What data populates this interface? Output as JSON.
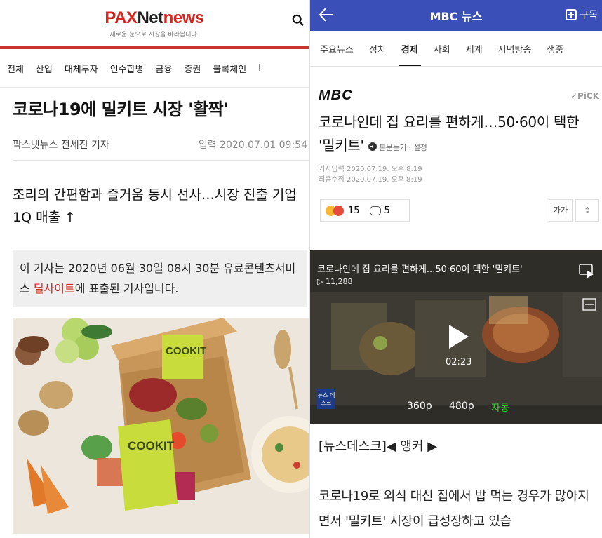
{
  "left": {
    "logo": {
      "pax": "PAX",
      "net": "Net",
      "news": "news"
    },
    "tagline": "새로운 눈으로 시장을 바라봅니다.",
    "nav": [
      "전체",
      "산업",
      "대체투자",
      "인수합병",
      "금융",
      "증권",
      "블록체인",
      "I"
    ],
    "title": "코로나19에 밀키트 시장 '활짝'",
    "byline": "팍스넷뉴스 전세진 기자",
    "date": "입력 2020.07.01 09:54",
    "subtitle": "조리의 간편함과 즐거움 동시 선사…시장 진출 기업 1Q 매출 ↑",
    "notice": {
      "prefix": "이 기사는 2020년 06월 30일 08시 30분 유료콘텐츠서비스 ",
      "highlight": "딜사이트",
      "suffix": "에 표출된 기사입니다."
    },
    "image": {
      "box_label_1": "COOKIT",
      "box_label_2": "COOKIT"
    }
  },
  "right": {
    "header": {
      "title": "MBC 뉴스",
      "subscribe": "구독"
    },
    "tabs": [
      "주요뉴스",
      "정치",
      "경제",
      "사회",
      "세계",
      "서녁방송",
      "생중"
    ],
    "active_tab": "경제",
    "press": "MBC",
    "pick": "✓PiCK",
    "headline": "코로나인데 집 요리를 편하게…50·60이 택한 '밀키트'",
    "listen": "본문듣기 · 설정",
    "meta": {
      "posted": "기사입력 2020.07.19. 오후 8:19",
      "updated": "최종수정 2020.07.19. 오후 8:19"
    },
    "reactions": {
      "emoji_count": "15",
      "comment_count": "5"
    },
    "buttons": {
      "font": "가가",
      "share": "⇪"
    },
    "video": {
      "title": "코로나인데 집 요리를 편하게...50·60이 택한 '밀키트'",
      "views": "▷ 11,288",
      "duration": "02:23",
      "quality": [
        "360p",
        "480p",
        "자동"
      ],
      "badge": "뉴스 데스크"
    },
    "anchor": "[뉴스데스크]◀ 앵커 ▶",
    "body": "코로나19로 외식 대신 집에서 밥 먹는 경우가 많아지면서 '밀키트' 시장이 급성장하고 있습"
  },
  "colors": {
    "pax_red": "#d7261f",
    "mbc_blue": "#3b4fb8",
    "auto_green": "#2fd12f"
  }
}
